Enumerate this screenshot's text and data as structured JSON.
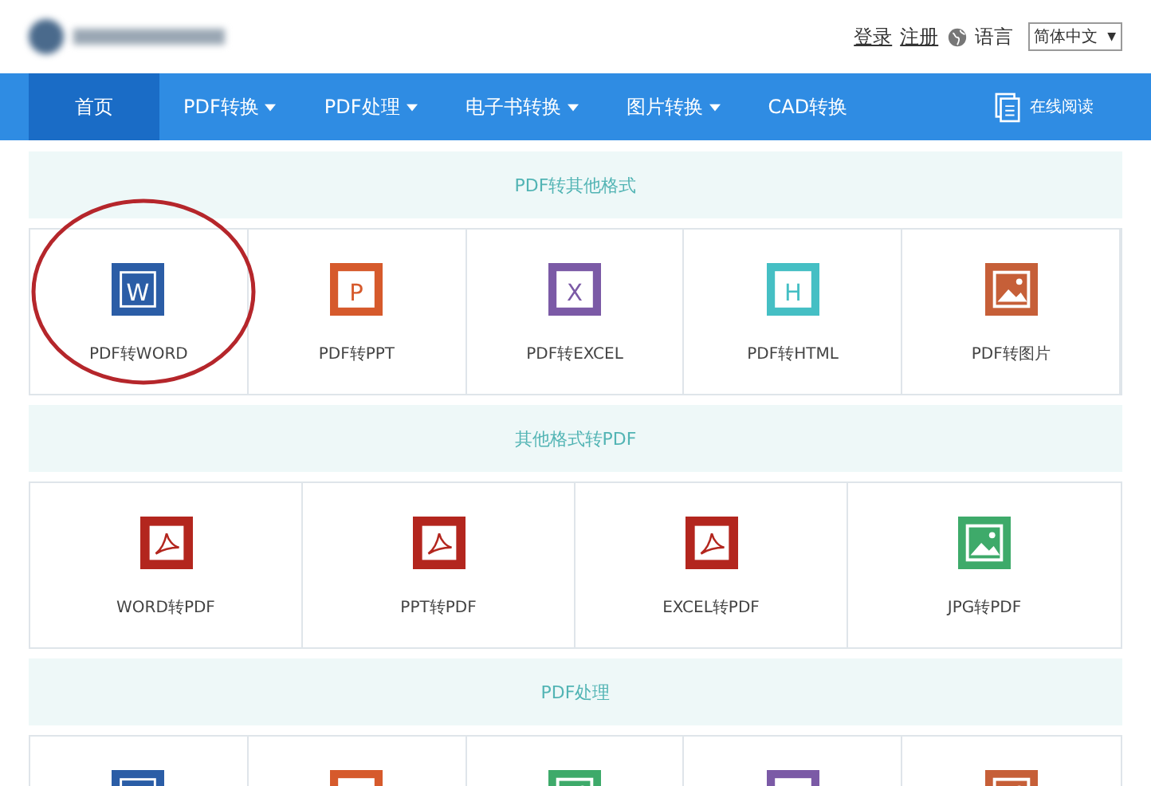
{
  "header": {
    "links": [
      "登录",
      "注册"
    ],
    "language_label": "语言",
    "language_select": {
      "value": "简体中文",
      "arrow": "▼"
    }
  },
  "nav": {
    "items": [
      {
        "label": "首页",
        "dropdown": false,
        "selected": true
      },
      {
        "label": "PDF转换",
        "dropdown": true,
        "selected": false
      },
      {
        "label": "PDF处理",
        "dropdown": true,
        "selected": false
      },
      {
        "label": "电子书转换",
        "dropdown": true,
        "selected": false
      },
      {
        "label": "图片转换",
        "dropdown": true,
        "selected": false
      },
      {
        "label": "CAD转换",
        "dropdown": false,
        "selected": false
      }
    ],
    "online_read": "在线阅读"
  },
  "sections": [
    {
      "title": "PDF转其他格式",
      "items": [
        {
          "kind": "word",
          "letter": "W",
          "label": "PDF转WORD",
          "circled": true
        },
        {
          "kind": "ppt",
          "letter": "P",
          "label": "PDF转PPT",
          "circled": false
        },
        {
          "kind": "excel",
          "letter": "X",
          "label": "PDF转EXCEL",
          "circled": false
        },
        {
          "kind": "html",
          "letter": "H",
          "label": "PDF转HTML",
          "circled": false
        },
        {
          "kind": "image",
          "label": "PDF转图片",
          "circled": false
        }
      ]
    },
    {
      "title": "其他格式转PDF",
      "items": [
        {
          "kind": "pdf",
          "label": "WORD转PDF",
          "circled": false
        },
        {
          "kind": "pdf",
          "label": "PPT转PDF",
          "circled": false
        },
        {
          "kind": "pdf",
          "label": "EXCEL转PDF",
          "circled": false
        },
        {
          "kind": "jpg",
          "label": "JPG转PDF",
          "circled": false
        }
      ]
    },
    {
      "title": "PDF处理",
      "items": [
        {
          "kind": "word",
          "circled": false
        },
        {
          "kind": "ppt",
          "circled": false
        },
        {
          "kind": "jpg",
          "circled": false
        },
        {
          "kind": "excel",
          "circled": false
        },
        {
          "kind": "image",
          "circled": false
        }
      ]
    }
  ]
}
